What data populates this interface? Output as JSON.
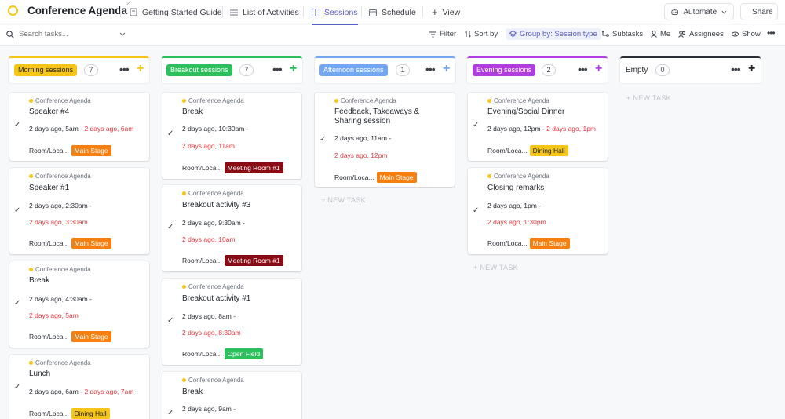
{
  "header": {
    "title": "Conference Agenda",
    "tabs": [
      {
        "label": "Getting Started Guide"
      },
      {
        "label": "List of Activities"
      },
      {
        "label": "Sessions"
      },
      {
        "label": "Schedule"
      },
      {
        "label": "View"
      }
    ],
    "automate": "Automate",
    "share": "Share",
    "tab_badge": "2"
  },
  "toolbar": {
    "search_placeholder": "Search tasks...",
    "filter": "Filter",
    "sort": "Sort by",
    "group": "Group by: Session type",
    "subtasks": "Subtasks",
    "me": "Me",
    "assignees": "Assignees",
    "show": "Show"
  },
  "colors": {
    "accent": "#5b5fc7",
    "morning": "#f5c518",
    "breakout": "#2cc05d",
    "afternoon": "#73a7f2",
    "evening": "#b03de0",
    "overdue": "#e5373c"
  },
  "columns": [
    {
      "name": "Morning sessions",
      "count": "7",
      "cards": [
        {
          "crumb": "Conference Agenda",
          "title": "Speaker #4",
          "start": "2 days ago, 5am",
          "due": "2 days ago, 6am",
          "room_label": "Room/Loca...",
          "room": "Main Stage"
        },
        {
          "crumb": "Conference Agenda",
          "title": "Speaker #1",
          "start": "2 days ago, 2:30am",
          "due": "2 days ago, 3:30am",
          "room_label": "Room/Loca...",
          "room": "Main Stage"
        },
        {
          "crumb": "Conference Agenda",
          "title": "Break",
          "start": "2 days ago, 4:30am",
          "due": "2 days ago, 5am",
          "room_label": "Room/Loca...",
          "room": "Main Stage"
        },
        {
          "crumb": "Conference Agenda",
          "title": "Lunch",
          "start": "2 days ago, 6am",
          "due": "2 days ago, 7am",
          "room_label": "Room/Loca...",
          "room": "Dining Hall"
        }
      ]
    },
    {
      "name": "Breakout sessions",
      "count": "7",
      "cards": [
        {
          "crumb": "Conference Agenda",
          "title": "Break",
          "start": "2 days ago, 10:30am",
          "due": "2 days ago, 11am",
          "room_label": "Room/Loca...",
          "room": "Meeting Room #1"
        },
        {
          "crumb": "Conference Agenda",
          "title": "Breakout activity #3",
          "start": "2 days ago, 9:30am",
          "due": "2 days ago, 10am",
          "room_label": "Room/Loca...",
          "room": "Meeting Room #1"
        },
        {
          "crumb": "Conference Agenda",
          "title": "Breakout activity #1",
          "start": "2 days ago, 8am",
          "due": "2 days ago, 8:30am",
          "room_label": "Room/Loca...",
          "room": "Open Field"
        },
        {
          "crumb": "Conference Agenda",
          "title": "Break",
          "start": "2 days ago, 9am",
          "due": "",
          "room_label": "",
          "room": ""
        }
      ]
    },
    {
      "name": "Afternoon sessions",
      "count": "1",
      "cards": [
        {
          "crumb": "Conference Agenda",
          "title": "Feedback, Takeaways & Sharing session",
          "start": "2 days ago, 11am",
          "due": "2 days ago, 12pm",
          "room_label": "Room/Loca...",
          "room": "Main Stage"
        }
      ],
      "new_task": "+ NEW TASK"
    },
    {
      "name": "Evening sessions",
      "count": "2",
      "cards": [
        {
          "crumb": "Conference Agenda",
          "title": "Evening/Social Dinner",
          "start": "2 days ago, 12pm",
          "due": "2 days ago, 1pm",
          "room_label": "Room/Loca...",
          "room": "Dining Hall"
        },
        {
          "crumb": "Conference Agenda",
          "title": "Closing remarks",
          "start": "2 days ago, 1pm",
          "due": "2 days ago, 1:30pm",
          "room_label": "Room/Loca...",
          "room": "Main Stage"
        }
      ],
      "new_task": "+ NEW TASK"
    },
    {
      "name": "Empty",
      "count": "0",
      "cards": [],
      "new_task": "+ NEW TASK"
    }
  ],
  "dash": "-"
}
